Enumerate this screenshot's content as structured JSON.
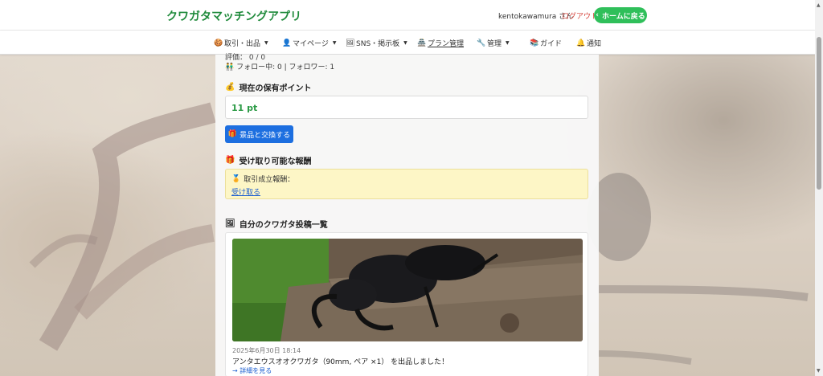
{
  "header": {
    "app_title": "クワガタマッチングアプリ",
    "user_name": "kentokawamura さん",
    "logout_label": "ログアウト",
    "home_button_label": "ホームに戻る",
    "home_button_icon": "‹"
  },
  "nav": {
    "items": [
      {
        "icon": "🍪",
        "label": "取引・出品",
        "dropdown": true
      },
      {
        "icon": "👤",
        "label": "マイページ",
        "dropdown": true
      },
      {
        "icon": "🖼",
        "label": "SNS・掲示板",
        "dropdown": true
      },
      {
        "icon": "🏯",
        "label": "プラン管理",
        "dropdown": false
      },
      {
        "icon": "🔧",
        "label": "管理",
        "dropdown": true
      },
      {
        "icon": "📚",
        "label": "ガイド",
        "dropdown": false
      },
      {
        "icon": "🔔",
        "label": "通知",
        "dropdown": false
      }
    ],
    "caret": "▼"
  },
  "profile": {
    "cut_line": "評価：  0 /   0",
    "follow_icon": "👬",
    "follow_text": "フォロー中: 0 | フォロワー: 1"
  },
  "points": {
    "heading_icon": "💰",
    "heading": "現在の保有ポイント",
    "value": "11 pt",
    "exchange_icon": "🎁",
    "exchange_label": "景品と交換する"
  },
  "rewards": {
    "heading_icon": "🎁",
    "heading": "受け取り可能な報酬",
    "item_icon": "🏅",
    "item_label": "取引成立報酬：",
    "claim_link": "受け取る"
  },
  "posts": {
    "heading_icon": "🖼",
    "heading": "自分のクワガタ投稿一覧",
    "items": [
      {
        "date": "2025年6月30日 18:14",
        "text": "アンタエウスオオクワガタ（90mm, ペア ×1） を出品しました！",
        "more": "→ 詳細を見る"
      }
    ]
  },
  "colors": {
    "brand_green": "#1f8a3b",
    "home_button": "#2fbf5a",
    "exchange_button": "#1d6fe0",
    "logout": "#d6453d",
    "reward_bg": "#fdf6c6",
    "points_text": "#2b9a45"
  }
}
